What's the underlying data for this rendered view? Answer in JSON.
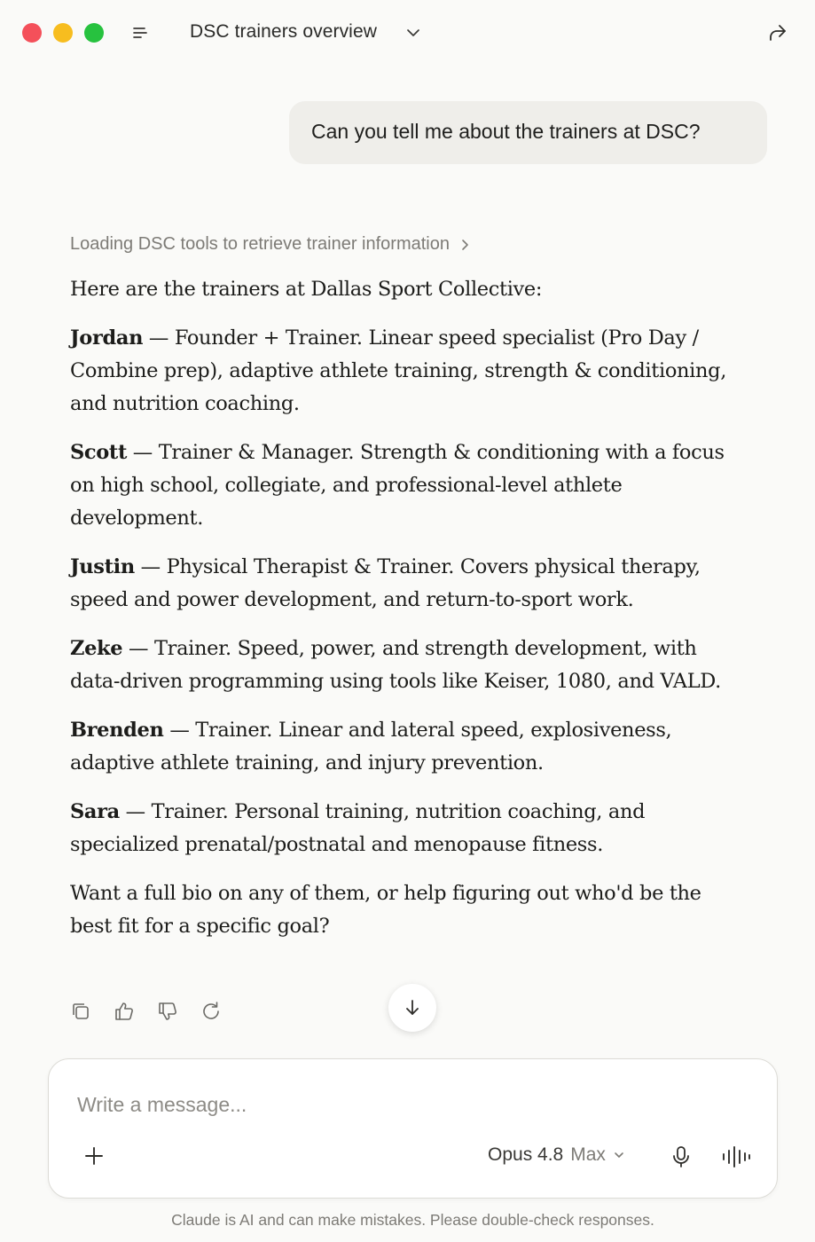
{
  "window": {
    "title": "DSC trainers overview"
  },
  "conversation": {
    "user_message": "Can you tell me about the trainers at DSC?",
    "tool_status": "Loading DSC tools to retrieve trainer information",
    "intro": "Here are the trainers at Dallas Sport Collective:",
    "trainers": [
      {
        "name": "Jordan",
        "description": " — Founder + Trainer. Linear speed specialist (Pro Day / Combine prep), adaptive athlete training, strength & conditioning, and nutrition coaching."
      },
      {
        "name": "Scott",
        "description": " — Trainer & Manager. Strength & conditioning with a focus on high school, collegiate, and professional-level athlete development."
      },
      {
        "name": "Justin",
        "description": " — Physical Therapist & Trainer. Covers physical therapy, speed and power development, and return-to-sport work."
      },
      {
        "name": "Zeke",
        "description": " — Trainer. Speed, power, and strength development, with data-driven programming using tools like Keiser, 1080, and VALD."
      },
      {
        "name": "Brenden",
        "description": " — Trainer. Linear and lateral speed, explosiveness, adaptive athlete training, and injury prevention."
      },
      {
        "name": "Sara",
        "description": " — Trainer. Personal training, nutrition coaching, and specialized prenatal/postnatal and menopause fitness."
      }
    ],
    "closing": "Want a full bio on any of them, or help figuring out who'd be the best fit for a specific goal?"
  },
  "composer": {
    "placeholder": "Write a message...",
    "model_name": "Opus 4.8",
    "model_mode": "Max"
  },
  "footer": {
    "disclaimer": "Claude is AI and can make mistakes. Please double-check responses."
  },
  "icons": {
    "menu": "menu-icon",
    "title_dropdown": "chevron-down-icon",
    "share": "share-icon",
    "tool_expand": "chevron-right-icon",
    "copy": "copy-icon",
    "thumbs_up": "thumbs-up-icon",
    "thumbs_down": "thumbs-down-icon",
    "retry": "retry-icon",
    "scroll_down": "arrow-down-icon",
    "add": "plus-icon",
    "microphone": "microphone-icon",
    "voice": "voice-waveform-icon"
  },
  "colors": {
    "close": "#f4505a",
    "minimize": "#f7bd1f",
    "zoom": "#27c23f",
    "background": "#fafaf8",
    "user_bubble": "#efeeea"
  }
}
